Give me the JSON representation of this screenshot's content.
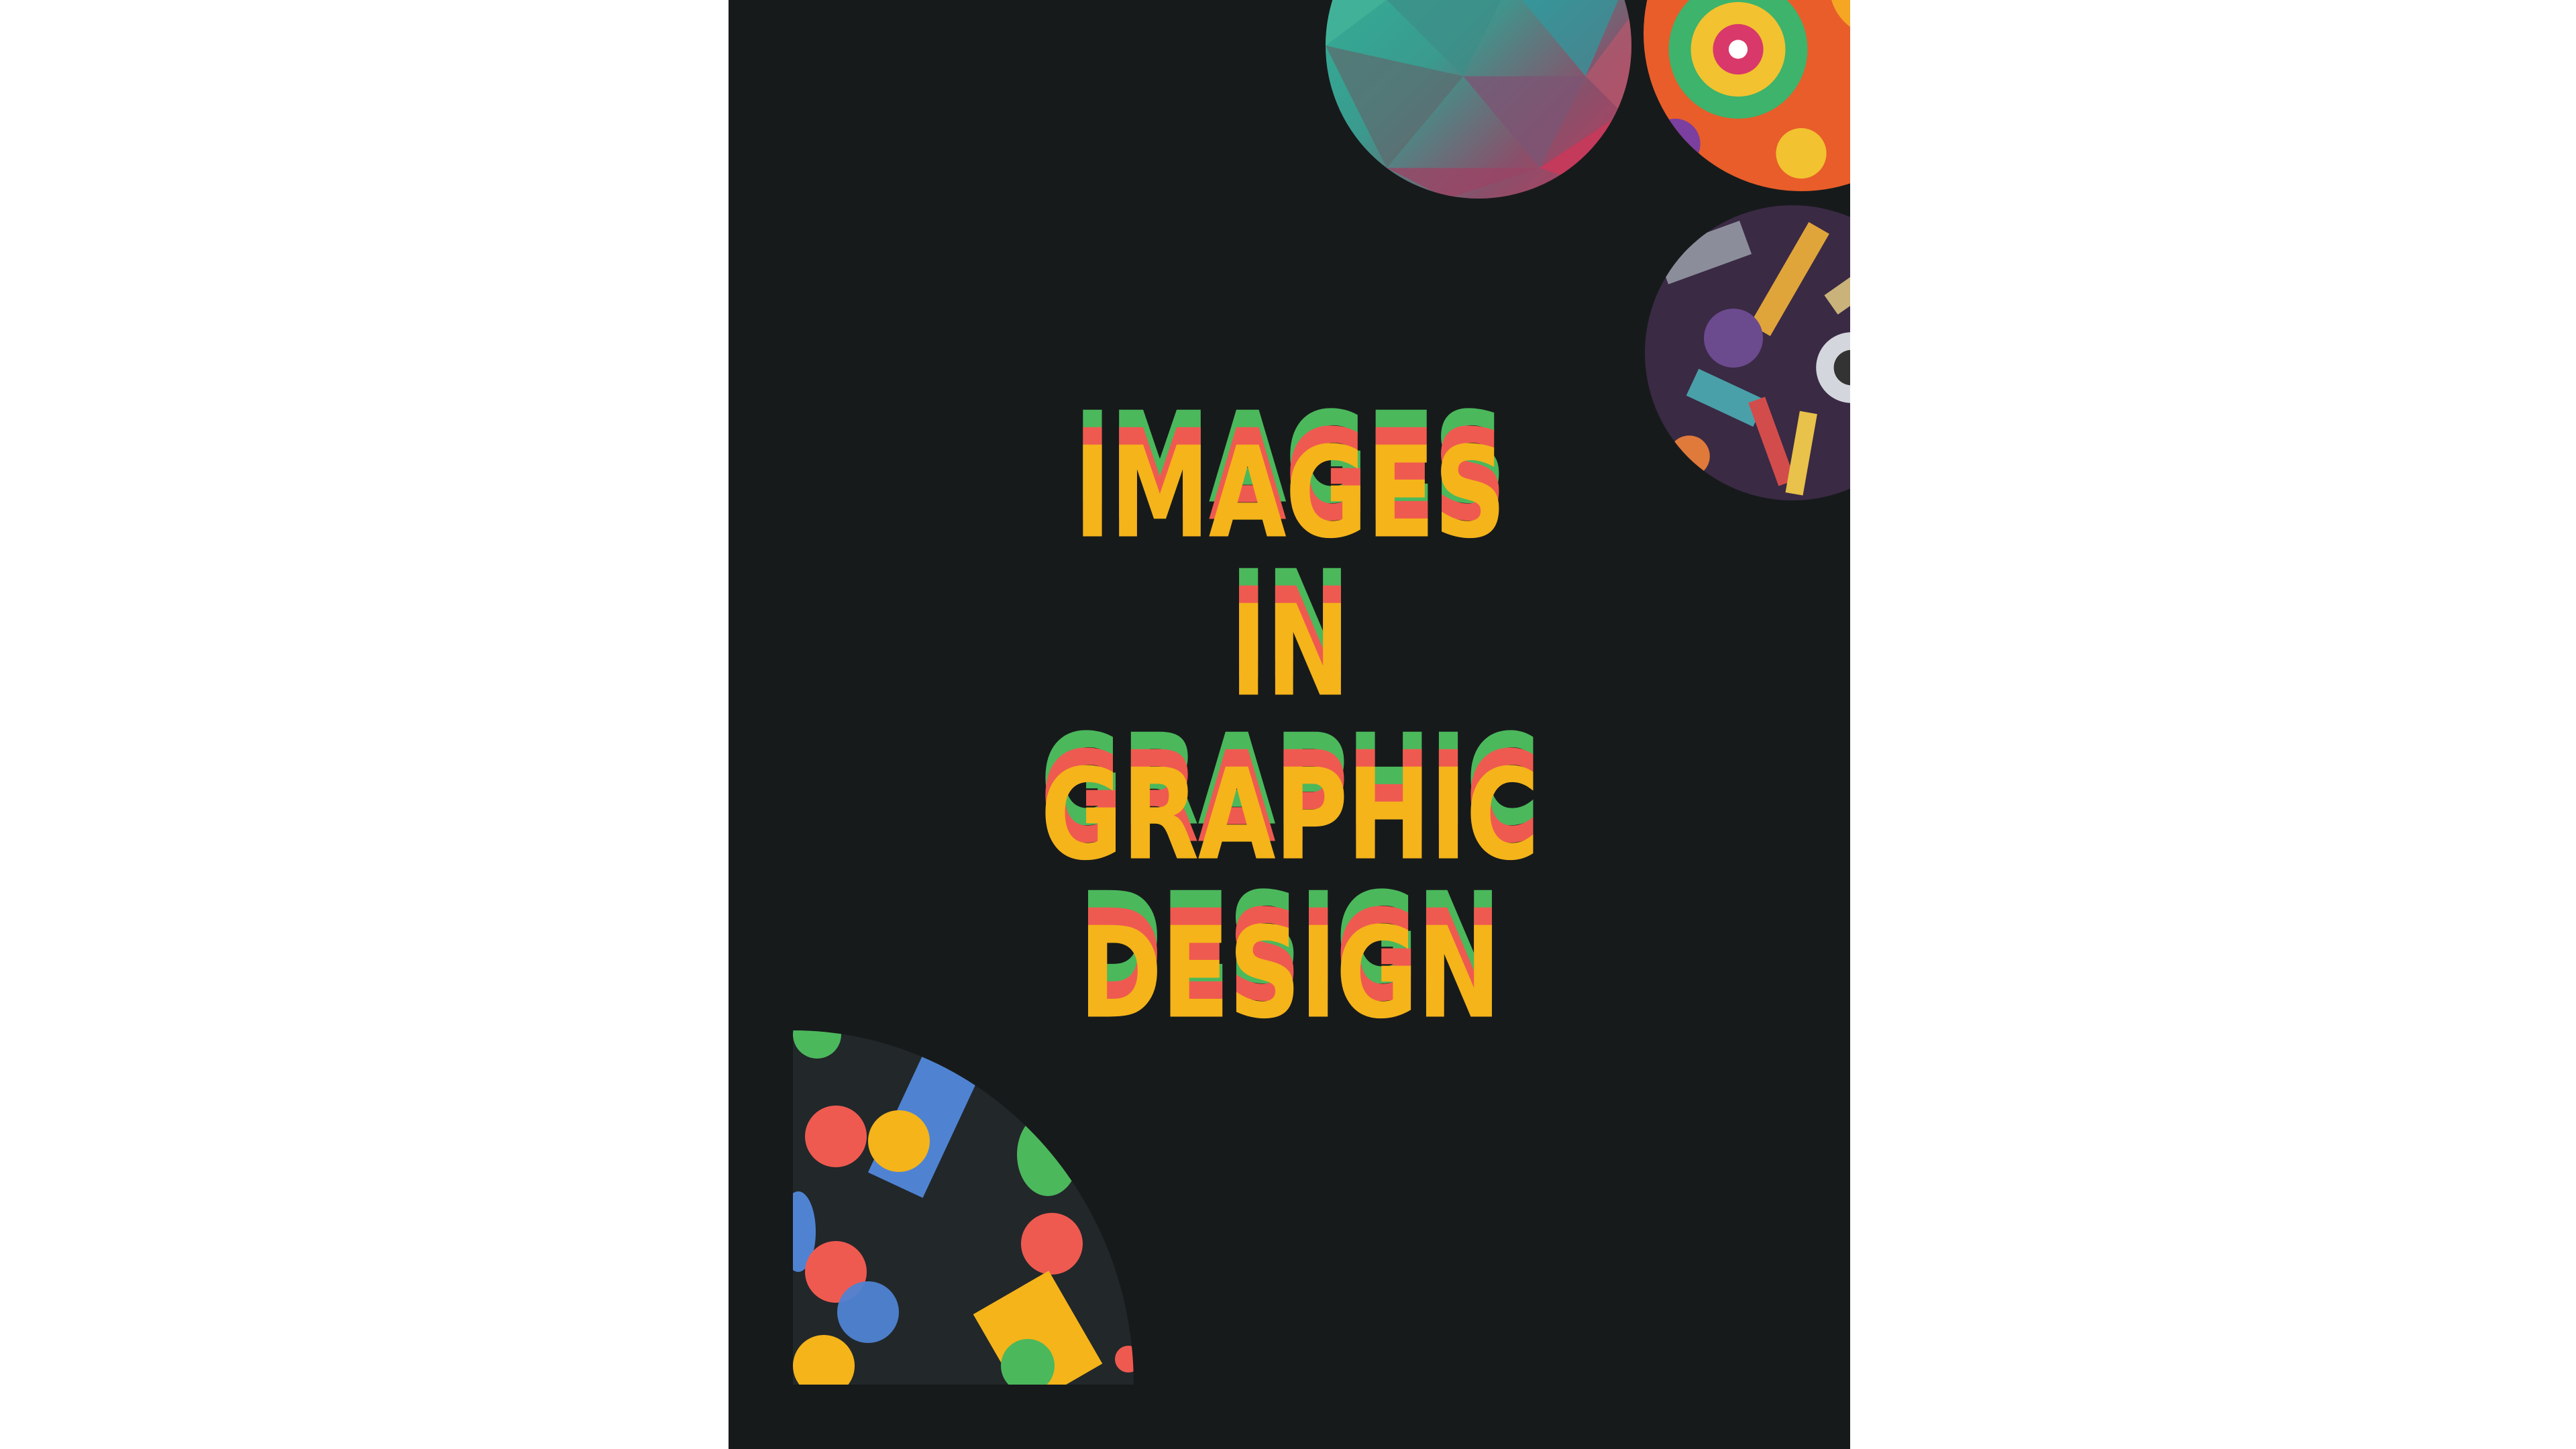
{
  "poster": {
    "title_lines": [
      "IMAGES",
      "IN",
      "GRAPHIC",
      "DESIGN"
    ],
    "colors": {
      "background": "#171a1b",
      "page": "#ffffff",
      "title_green": "#4bb85c",
      "title_red": "#ef5a50",
      "title_yellow": "#f4b41a",
      "shape_blue": "#4f83d2"
    },
    "decorations": [
      "low-poly-gradient-circle",
      "mandala-pattern-circle",
      "art-supplies-doodle-circle",
      "geometric-shapes-quarter-circle"
    ]
  }
}
